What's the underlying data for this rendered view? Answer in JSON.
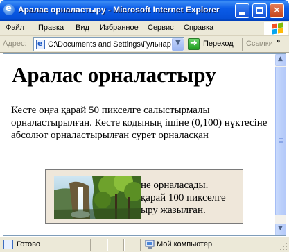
{
  "window": {
    "title": "Аралас орналастыру - Microsoft Internet Explorer"
  },
  "menu": [
    "Файл",
    "Правка",
    "Вид",
    "Избранное",
    "Сервис",
    "Справка"
  ],
  "address": {
    "label": "Адрес:",
    "value": "C:\\Documents and Settings\\Гульнар",
    "go_label": "Переход",
    "links_label": "Ссылки"
  },
  "page": {
    "heading": "Аралас орналастыру",
    "paragraph": "Кесте оңға қарай 50 пикселге салыстырмалы орналастырылған. Кесте кодының ішіне (0,100) нүктесіне абсолют орналастырылған сурет орналасқан",
    "box_text": "Сурет кестенің ішіне орналасады. Кестенің шетінен оңға қарай 100 пикселге ығыстырылып, үстіне жазу жазылған.",
    "box_text_visible_lines": [
      "не орналасады.",
      "қарай 100 пикселге",
      "ыру жазылған."
    ]
  },
  "status": {
    "text": "Готово",
    "zone": "Мой компьютер"
  },
  "colors": {
    "titlebar": "#0650d8",
    "chrome": "#ece9d8",
    "box_bg": "#efe7da"
  },
  "icons": [
    "ie-icon",
    "minimize-icon",
    "maximize-icon",
    "close-icon",
    "windows-logo-icon",
    "page-icon",
    "dropdown-icon",
    "go-arrow-icon",
    "scroll-up-icon",
    "scroll-down-icon",
    "computer-icon"
  ]
}
